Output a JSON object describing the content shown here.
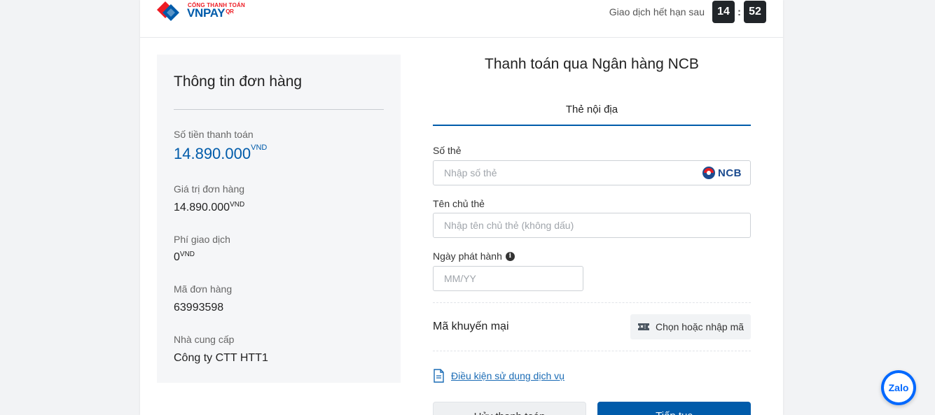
{
  "header": {
    "logo_sub": "CỔNG THANH TOÁN",
    "logo_main": "VNPAY",
    "logo_suffix": "QR",
    "timer_label": "Giao dịch hết hạn sau",
    "timer_minutes": "14",
    "timer_colon": ":",
    "timer_seconds": "52"
  },
  "order": {
    "title": "Thông tin đơn hàng",
    "amount_label": "Số tiền thanh toán",
    "amount_value": "14.890.000",
    "amount_unit": "VND",
    "order_value_label": "Giá trị đơn hàng",
    "order_value": "14.890.000",
    "order_value_unit": "VND",
    "fee_label": "Phí giao dịch",
    "fee_value": "0",
    "fee_unit": "VND",
    "order_id_label": "Mã đơn hàng",
    "order_id": "63993598",
    "provider_label": "Nhà cung cấp",
    "provider": "Công ty CTT HTT1"
  },
  "payment": {
    "title": "Thanh toán qua Ngân hàng NCB",
    "tab_label": "Thẻ nội địa",
    "bank_logo_text": "NCB",
    "card_number_label": "Số thẻ",
    "card_number_placeholder": "Nhập số thẻ",
    "card_holder_label": "Tên chủ thẻ",
    "card_holder_placeholder": "Nhập tên chủ thẻ (không dấu)",
    "issue_date_label": "Ngày phát hành",
    "issue_date_placeholder": "MM/YY",
    "promo_label": "Mã khuyến mại",
    "promo_button": "Chọn hoặc nhập mã",
    "terms_link": "Điều kiện sử dụng dịch vụ",
    "cancel_button": "Hủy thanh toán",
    "next_button": "Tiếp tục"
  },
  "zalo": {
    "label": "Zalo"
  },
  "colors": {
    "brand_blue": "#005baa",
    "brand_red": "#ed1c24",
    "timer_bg": "#212529",
    "zalo_blue": "#0068ff"
  }
}
